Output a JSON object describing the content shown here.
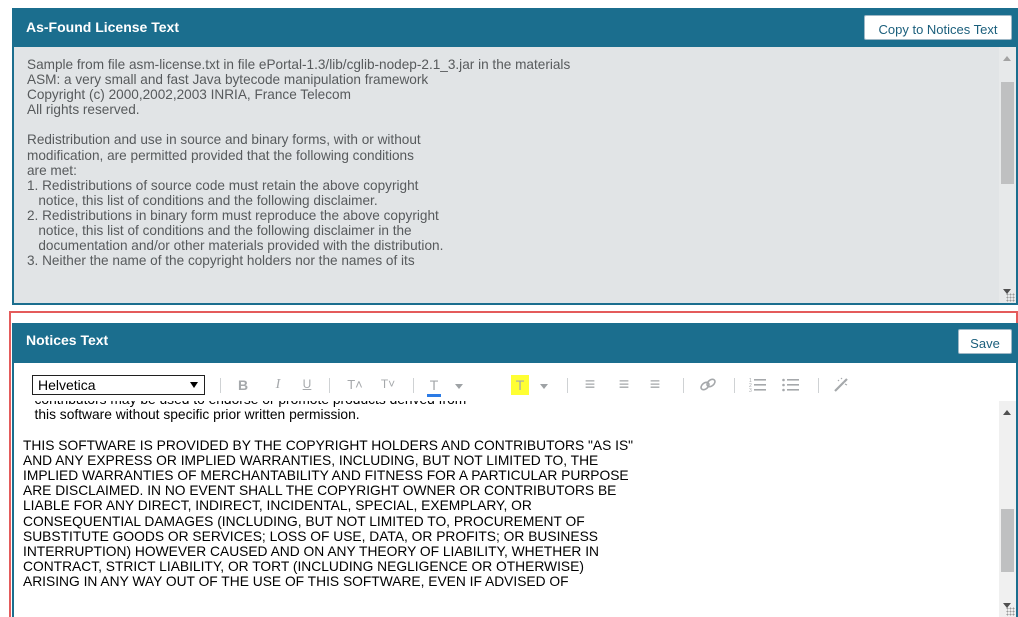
{
  "found_panel": {
    "title": "As-Found License Text",
    "copy_button": "Copy to Notices Text",
    "text": "Sample from file asm-license.txt in file ePortal-1.3/lib/cglib-nodep-2.1_3.jar in the materials\nASM: a very small and fast Java bytecode manipulation framework\nCopyright (c) 2000,2002,2003 INRIA, France Telecom\nAll rights reserved.\n\nRedistribution and use in source and binary forms, with or without\nmodification, are permitted provided that the following conditions\nare met:\n1. Redistributions of source code must retain the above copyright\n   notice, this list of conditions and the following disclaimer.\n2. Redistributions in binary form must reproduce the above copyright\n   notice, this list of conditions and the following disclaimer in the\n   documentation and/or other materials provided with the distribution.\n3. Neither the name of the copyright holders nor the names of its",
    "scroll_position": 0.0
  },
  "notices_panel": {
    "title": "Notices Text",
    "save_button": "Save",
    "toolbar": {
      "font": "Helvetica",
      "buttons": [
        {
          "name": "bold",
          "label": "B"
        },
        {
          "name": "italic",
          "label": "I"
        },
        {
          "name": "underline",
          "label": "U"
        },
        {
          "name": "font-size-increase",
          "label": "T˄"
        },
        {
          "name": "font-size-decrease",
          "label": "T˅"
        },
        {
          "name": "text-color",
          "label": "T"
        },
        {
          "name": "highlight",
          "label": "T"
        },
        {
          "name": "align-left",
          "label": "≡"
        },
        {
          "name": "align-center",
          "label": "≡"
        },
        {
          "name": "align-right",
          "label": "≡"
        },
        {
          "name": "link",
          "label": "🔗"
        },
        {
          "name": "ordered-list",
          "label": "☰"
        },
        {
          "name": "unordered-list",
          "label": "☰"
        },
        {
          "name": "clear-format",
          "label": "⁄"
        }
      ],
      "text_color": "#2c7be5",
      "highlight_color": "#ffff33"
    },
    "text": "   contributors may be used to endorse or promote products derived from\n   this software without specific prior written permission.\n\nTHIS SOFTWARE IS PROVIDED BY THE COPYRIGHT HOLDERS AND CONTRIBUTORS \"AS IS\"\nAND ANY EXPRESS OR IMPLIED WARRANTIES, INCLUDING, BUT NOT LIMITED TO, THE\nIMPLIED WARRANTIES OF MERCHANTABILITY AND FITNESS FOR A PARTICULAR PURPOSE\nARE DISCLAIMED. IN NO EVENT SHALL THE COPYRIGHT OWNER OR CONTRIBUTORS BE\nLIABLE FOR ANY DIRECT, INDIRECT, INCIDENTAL, SPECIAL, EXEMPLARY, OR\nCONSEQUENTIAL DAMAGES (INCLUDING, BUT NOT LIMITED TO, PROCUREMENT OF\nSUBSTITUTE GOODS OR SERVICES; LOSS OF USE, DATA, OR PROFITS; OR BUSINESS\nINTERRUPTION) HOWEVER CAUSED AND ON ANY THEORY OF LIABILITY, WHETHER IN\nCONTRACT, STRICT LIABILITY, OR TORT (INCLUDING NEGLIGENCE OR OTHERWISE)\nARISING IN ANY WAY OUT OF THE USE OF THIS SOFTWARE, EVEN IF ADVISED OF",
    "scroll_position": 1.0
  },
  "colors": {
    "header": "#1b6e8e",
    "selection_outline": "#e45b5b",
    "readonly_bg": "#e1e4e6"
  }
}
